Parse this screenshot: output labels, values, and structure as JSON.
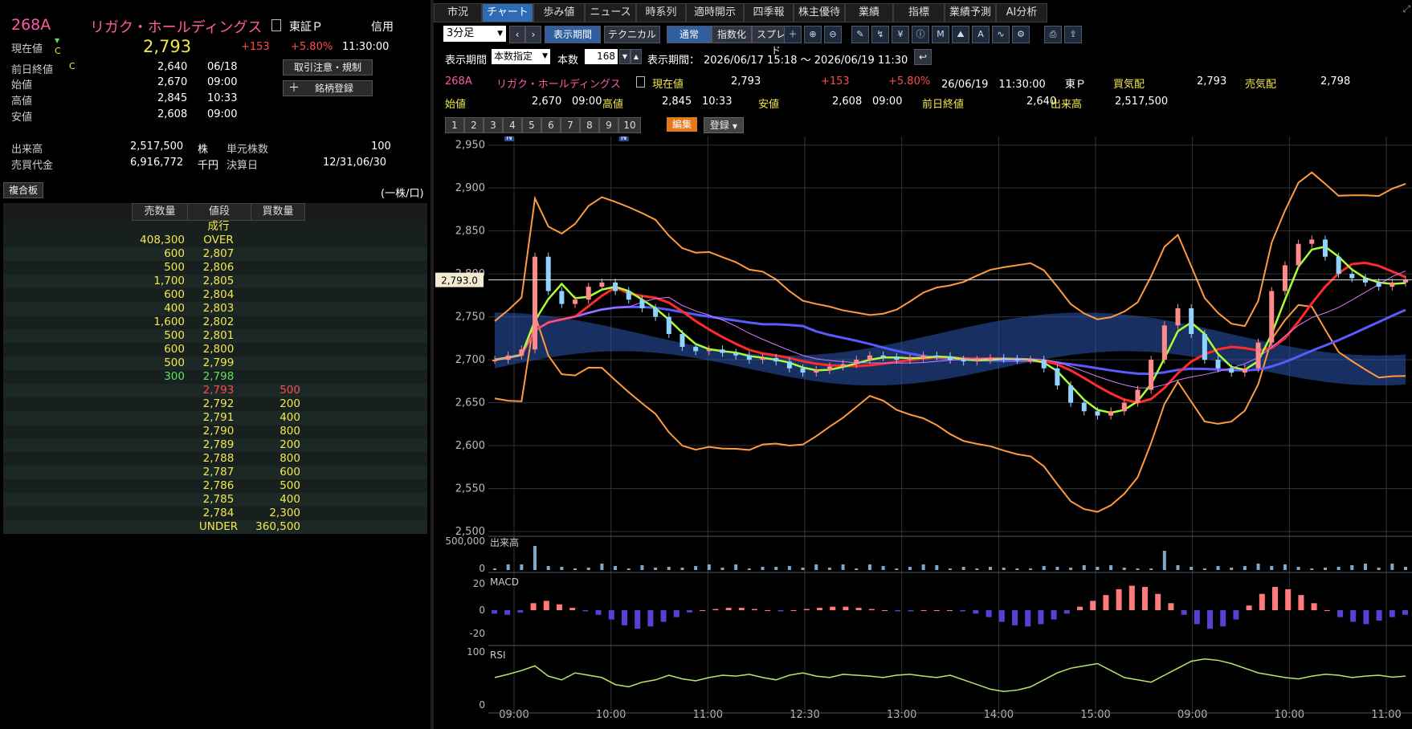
{
  "stock": {
    "code": "268A",
    "name": "リガク・ホールディングス",
    "market": "東証Ｐ",
    "margin": "信用",
    "price_label": "現在値",
    "price": "2,793",
    "change": "+153",
    "change_pct": "+5.80%",
    "time": "11:30:00",
    "indicator_c": "C",
    "prev_label": "前日終値",
    "prev_flag": "C",
    "prev_value": "2,640",
    "prev_date": "06/18",
    "open_label": "始値",
    "open_value": "2,670",
    "open_time": "09:00",
    "high_label": "高値",
    "high_value": "2,845",
    "high_time": "10:33",
    "low_label": "安値",
    "low_value": "2,608",
    "low_time": "09:00",
    "volume_label": "出来高",
    "volume_value": "2,517,500",
    "volume_unit": "株",
    "unit_label": "単元株数",
    "unit_value": "100",
    "turnover_label": "売買代金",
    "turnover_value": "6,916,772",
    "turnover_unit": "千円",
    "settle_label": "決算日",
    "settle_value": "12/31,06/30",
    "btn_caution": "取引注意・規制",
    "btn_register": "銘柄登録"
  },
  "board": {
    "title": "複合板",
    "unit": "(一株/口)",
    "headers": [
      "売数量",
      "値段",
      "買数量"
    ],
    "market_order": "成行",
    "asks": [
      {
        "qty": "408,300",
        "price": "OVER"
      },
      {
        "qty": "600",
        "price": "2,807"
      },
      {
        "qty": "500",
        "price": "2,806"
      },
      {
        "qty": "1,700",
        "price": "2,805"
      },
      {
        "qty": "600",
        "price": "2,804"
      },
      {
        "qty": "400",
        "price": "2,803"
      },
      {
        "qty": "1,600",
        "price": "2,802"
      },
      {
        "qty": "500",
        "price": "2,801"
      },
      {
        "qty": "600",
        "price": "2,800"
      },
      {
        "qty": "500",
        "price": "2,799"
      },
      {
        "qty": "300",
        "price": "2,798"
      }
    ],
    "bids": [
      {
        "price": "2,793",
        "qty": "500"
      },
      {
        "price": "2,792",
        "qty": "200"
      },
      {
        "price": "2,791",
        "qty": "400"
      },
      {
        "price": "2,790",
        "qty": "800"
      },
      {
        "price": "2,789",
        "qty": "200"
      },
      {
        "price": "2,788",
        "qty": "800"
      },
      {
        "price": "2,787",
        "qty": "600"
      },
      {
        "price": "2,786",
        "qty": "500"
      },
      {
        "price": "2,785",
        "qty": "400"
      },
      {
        "price": "2,784",
        "qty": "2,300"
      },
      {
        "price": "UNDER",
        "qty": "360,500"
      }
    ]
  },
  "tabs": [
    "市況",
    "チャート",
    "歩み値",
    "ニュース",
    "時系列",
    "適時開示",
    "四季報",
    "株主優待",
    "業績",
    "指標",
    "業績予測",
    "AI分析"
  ],
  "toolbar": {
    "interval": "3分足",
    "period_btn": "表示期間",
    "technical_btn": "テクニカル",
    "normal_btn": "通常",
    "index_btn": "指数化",
    "spread_btn": "スプレッド",
    "period_label": "表示期間",
    "period_mode": "本数指定",
    "count_label": "本数",
    "count_value": "168",
    "range_label": "表示期間：",
    "range_value": "2026/06/17 15:18 ～ 2026/06/19 11:30"
  },
  "chart_header": {
    "code": "268A",
    "name": "リガク・ホールディングス",
    "price_label": "現在値",
    "price": "2,793",
    "change": "+153",
    "change_pct": "+5.80%",
    "datetime": "26/06/19　11:30:00",
    "market": "東Ｐ",
    "bid_label": "買気配",
    "bid": "2,793",
    "ask_label": "売気配",
    "ask": "2,798",
    "open_label": "始値",
    "open": "2,670",
    "open_time": "09:00",
    "high_label": "高値",
    "high": "2,845",
    "high_time": "10:33",
    "low_label": "安値",
    "low": "2,608",
    "low_time": "09:00",
    "prev_label": "前日終値",
    "prev": "2,640",
    "vol_label": "出来高",
    "vol": "2,517,500"
  },
  "presets": [
    "1",
    "2",
    "3",
    "4",
    "5",
    "6",
    "7",
    "8",
    "9",
    "10"
  ],
  "edit_btn": "編集",
  "save_btn": "登録",
  "icons": [
    "plus-icon",
    "zoom-in-icon",
    "zoom-out-icon",
    "pen-icon",
    "line-draw-icon",
    "yen-icon",
    "info-icon",
    "my-icon",
    "mountain-icon",
    "auto-icon",
    "wave-icon",
    "wrench-icon",
    "print-icon",
    "export-icon"
  ],
  "chart_data": {
    "type": "line",
    "price_axis": [
      2950,
      2900,
      2850,
      2800,
      2750,
      2700,
      2650,
      2600,
      2550,
      2500
    ],
    "price_axis_labels": [
      "2,950",
      "2,900",
      "2,850",
      "2,800",
      "2,750",
      "2,700",
      "2,650",
      "2,600",
      "2,550",
      "2,500"
    ],
    "ylim": [
      2500,
      2960
    ],
    "current_marker": "2,793.0",
    "x_labels": [
      "09:00",
      "10:00",
      "11:00",
      "12:30",
      "13:00",
      "14:00",
      "15:00",
      "09:00",
      "10:00",
      "11:00"
    ],
    "news_markers": [
      "N",
      "N"
    ],
    "close": [
      2700,
      2705,
      2712,
      2820,
      2780,
      2765,
      2770,
      2785,
      2790,
      2780,
      2770,
      2760,
      2750,
      2730,
      2715,
      2710,
      2712,
      2708,
      2705,
      2700,
      2702,
      2698,
      2690,
      2685,
      2688,
      2692,
      2695,
      2700,
      2705,
      2703,
      2700,
      2702,
      2705,
      2704,
      2700,
      2698,
      2700,
      2702,
      2701,
      2700,
      2700,
      2690,
      2670,
      2650,
      2640,
      2635,
      2640,
      2650,
      2665,
      2700,
      2740,
      2760,
      2730,
      2700,
      2690,
      2685,
      2690,
      2720,
      2780,
      2810,
      2835,
      2840,
      2820,
      2800,
      2795,
      2790,
      2785,
      2790,
      2793
    ],
    "volume_label": "出来高",
    "volume_axis": [
      "500,000",
      "0"
    ],
    "macd_label": "MACD",
    "macd_axis": [
      "20",
      "0",
      "-20"
    ],
    "macd": [
      -3,
      -4,
      -2,
      6,
      8,
      5,
      2,
      -1,
      -4,
      -8,
      -13,
      -16,
      -14,
      -10,
      -6,
      -2,
      0,
      1,
      2,
      2,
      1,
      0,
      -1,
      0,
      1,
      2,
      3,
      3,
      2,
      1,
      0,
      -1,
      -1,
      0,
      0,
      0,
      -1,
      -3,
      -6,
      -10,
      -13,
      -14,
      -12,
      -8,
      -3,
      3,
      8,
      13,
      18,
      21,
      20,
      14,
      6,
      -4,
      -12,
      -16,
      -14,
      -8,
      4,
      14,
      20,
      18,
      13,
      6,
      0,
      -6,
      -10,
      -12,
      -9,
      -6,
      -4
    ],
    "rsi_label": "RSI",
    "rsi_axis": [
      "100",
      "0"
    ],
    "rsi": [
      45,
      52,
      60,
      70,
      48,
      40,
      55,
      50,
      45,
      30,
      25,
      35,
      40,
      50,
      42,
      38,
      45,
      50,
      48,
      52,
      45,
      40,
      50,
      55,
      48,
      45,
      52,
      50,
      48,
      45,
      50,
      52,
      48,
      45,
      50,
      40,
      30,
      20,
      15,
      18,
      25,
      40,
      55,
      65,
      70,
      75,
      60,
      45,
      40,
      35,
      50,
      65,
      80,
      85,
      82,
      75,
      65,
      55,
      50,
      45,
      42,
      48,
      52,
      50,
      45,
      48,
      50,
      46,
      48
    ]
  }
}
